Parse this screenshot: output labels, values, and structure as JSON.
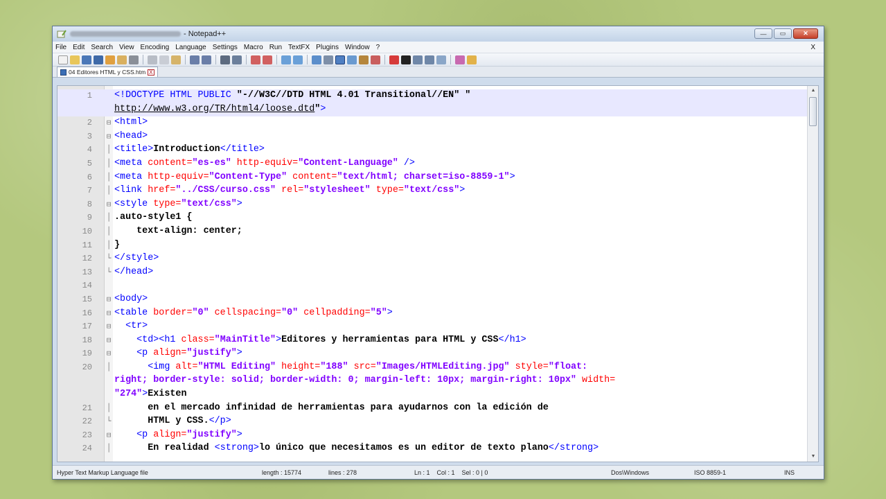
{
  "window": {
    "title_suffix": "- Notepad++",
    "minimize": "—",
    "maximize": "▭",
    "close": "✕"
  },
  "menu": {
    "items": [
      "File",
      "Edit",
      "Search",
      "View",
      "Encoding",
      "Language",
      "Settings",
      "Macro",
      "Run",
      "TextFX",
      "Plugins",
      "Window",
      "?"
    ],
    "close": "X"
  },
  "tab": {
    "label": "04 Editores HTML y CSS.htm",
    "close": "X"
  },
  "editor": {
    "lines": [
      {
        "n": "1",
        "fold": "",
        "parts": [
          [
            "t",
            "<!DOCTYPE HTML PUBLIC "
          ],
          [
            "x",
            "\"-//W3C//DTD HTML 4.01 Transitional//EN\""
          ],
          [
            "x",
            " \""
          ]
        ],
        "hl": true
      },
      {
        "n": "",
        "fold": "",
        "parts": [
          [
            "u",
            "http://www.w3.org/TR/html4/loose.dtd"
          ],
          [
            "x",
            "\""
          ],
          [
            "t",
            ">"
          ]
        ],
        "hl": true
      },
      {
        "n": "2",
        "fold": "⊟",
        "parts": [
          [
            "t",
            "<html>"
          ]
        ]
      },
      {
        "n": "3",
        "fold": "⊟",
        "parts": [
          [
            "t",
            "<head>"
          ]
        ]
      },
      {
        "n": "4",
        "fold": "│",
        "parts": [
          [
            "t",
            "<title>"
          ],
          [
            "x",
            "Introduction"
          ],
          [
            "t",
            "</title>"
          ]
        ]
      },
      {
        "n": "5",
        "fold": "│",
        "parts": [
          [
            "t",
            "<meta "
          ],
          [
            "a",
            "content="
          ],
          [
            "v",
            "\"es-es\""
          ],
          [
            "a",
            " http-equiv="
          ],
          [
            "v",
            "\"Content-Language\""
          ],
          [
            "t",
            " />"
          ]
        ]
      },
      {
        "n": "6",
        "fold": "│",
        "parts": [
          [
            "t",
            "<meta "
          ],
          [
            "a",
            "http-equiv="
          ],
          [
            "v",
            "\"Content-Type\""
          ],
          [
            "a",
            " content="
          ],
          [
            "v",
            "\"text/html; charset=iso-8859-1\""
          ],
          [
            "t",
            ">"
          ]
        ]
      },
      {
        "n": "7",
        "fold": "│",
        "parts": [
          [
            "t",
            "<link "
          ],
          [
            "a",
            "href="
          ],
          [
            "v",
            "\"../CSS/curso.css\""
          ],
          [
            "a",
            " rel="
          ],
          [
            "v",
            "\"stylesheet\""
          ],
          [
            "a",
            " type="
          ],
          [
            "v",
            "\"text/css\""
          ],
          [
            "t",
            ">"
          ]
        ]
      },
      {
        "n": "8",
        "fold": "⊟",
        "parts": [
          [
            "t",
            "<style "
          ],
          [
            "a",
            "type="
          ],
          [
            "v",
            "\"text/css\""
          ],
          [
            "t",
            ">"
          ]
        ]
      },
      {
        "n": "9",
        "fold": "│",
        "parts": [
          [
            "x",
            ".auto-style1 {"
          ]
        ]
      },
      {
        "n": "10",
        "fold": "│",
        "parts": [
          [
            "x",
            "    text-align: center;"
          ]
        ]
      },
      {
        "n": "11",
        "fold": "│",
        "parts": [
          [
            "x",
            "}"
          ]
        ]
      },
      {
        "n": "12",
        "fold": "└",
        "parts": [
          [
            "t",
            "</style>"
          ]
        ]
      },
      {
        "n": "13",
        "fold": "└",
        "parts": [
          [
            "t",
            "</head>"
          ]
        ]
      },
      {
        "n": "14",
        "fold": "",
        "parts": [
          [
            "x",
            ""
          ]
        ]
      },
      {
        "n": "15",
        "fold": "⊟",
        "parts": [
          [
            "t",
            "<body>"
          ]
        ]
      },
      {
        "n": "16",
        "fold": "⊟",
        "parts": [
          [
            "t",
            "<table "
          ],
          [
            "a",
            "border="
          ],
          [
            "v",
            "\"0\""
          ],
          [
            "a",
            " cellspacing="
          ],
          [
            "v",
            "\"0\""
          ],
          [
            "a",
            " cellpadding="
          ],
          [
            "v",
            "\"5\""
          ],
          [
            "t",
            ">"
          ]
        ]
      },
      {
        "n": "17",
        "fold": "⊟",
        "parts": [
          [
            "t",
            "  <tr>"
          ]
        ]
      },
      {
        "n": "18",
        "fold": "⊟",
        "parts": [
          [
            "t",
            "    <td><h1 "
          ],
          [
            "a",
            "class="
          ],
          [
            "v",
            "\"MainTitle\""
          ],
          [
            "t",
            ">"
          ],
          [
            "x",
            "Editores y herramientas para HTML y CSS"
          ],
          [
            "t",
            "</h1>"
          ]
        ]
      },
      {
        "n": "19",
        "fold": "⊟",
        "parts": [
          [
            "t",
            "    <p "
          ],
          [
            "a",
            "align="
          ],
          [
            "v",
            "\"justify\""
          ],
          [
            "t",
            ">"
          ]
        ]
      },
      {
        "n": "20",
        "fold": "│",
        "parts": [
          [
            "t",
            "      <img "
          ],
          [
            "a",
            "alt="
          ],
          [
            "v",
            "\"HTML Editing\""
          ],
          [
            "a",
            " height="
          ],
          [
            "v",
            "\"188\""
          ],
          [
            "a",
            " src="
          ],
          [
            "v",
            "\"Images/HTMLEditing.jpg\""
          ],
          [
            "a",
            " style="
          ],
          [
            "v",
            "\"float:"
          ]
        ]
      },
      {
        "n": "",
        "fold": "",
        "parts": [
          [
            "v",
            "right; border-style: solid; border-width: 0; margin-left: 10px; margin-right: 10px\""
          ],
          [
            "a",
            " width="
          ]
        ]
      },
      {
        "n": "",
        "fold": "",
        "parts": [
          [
            "v",
            "\"274\""
          ],
          [
            "t",
            ">"
          ],
          [
            "x",
            "Existen"
          ]
        ]
      },
      {
        "n": "21",
        "fold": "│",
        "parts": [
          [
            "x",
            "      en el mercado infinidad de herramientas para ayudarnos con la edición de"
          ]
        ]
      },
      {
        "n": "22",
        "fold": "└",
        "parts": [
          [
            "x",
            "      HTML y CSS."
          ],
          [
            "t",
            "</p>"
          ]
        ]
      },
      {
        "n": "23",
        "fold": "⊟",
        "parts": [
          [
            "t",
            "    <p "
          ],
          [
            "a",
            "align="
          ],
          [
            "v",
            "\"justify\""
          ],
          [
            "t",
            ">"
          ]
        ]
      },
      {
        "n": "24",
        "fold": "│",
        "parts": [
          [
            "x",
            "      En realidad "
          ],
          [
            "t",
            "<strong>"
          ],
          [
            "x",
            "lo único que necesitamos es un editor de texto plano"
          ],
          [
            "t",
            "</strong>"
          ]
        ]
      }
    ]
  },
  "status": {
    "filetype": "Hyper Text Markup Language file",
    "length": "length : 15774",
    "lines": "lines : 278",
    "position": "Ln : 1    Col : 1    Sel : 0 | 0",
    "eol": "Dos\\Windows",
    "encoding": "ISO 8859-1",
    "mode": "INS"
  },
  "colors": {
    "tag": "#0000ff",
    "attr": "#ff0000",
    "value": "#8000ff",
    "text": "#000000",
    "highlight": "#e8e8ff"
  }
}
